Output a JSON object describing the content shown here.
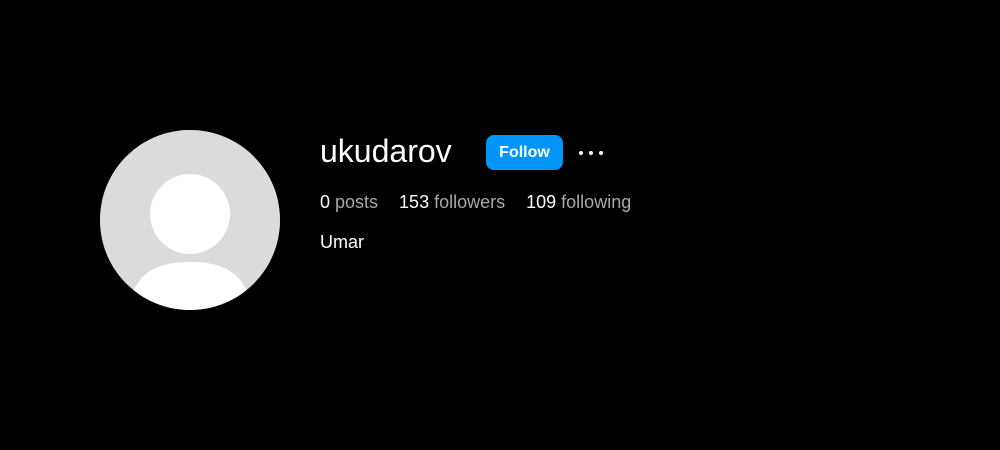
{
  "profile": {
    "username": "ukudarov",
    "full_name": "Umar",
    "avatar_icon": "default-user-icon"
  },
  "actions": {
    "follow_label": "Follow",
    "more_icon": "more-options-icon"
  },
  "stats": {
    "posts_count": "0",
    "posts_label": "posts",
    "followers_count": "153",
    "followers_label": "followers",
    "following_count": "109",
    "following_label": "following"
  },
  "colors": {
    "background": "#000000",
    "accent": "#0095f6",
    "secondary_text": "#a8a8a8",
    "avatar_bg": "#dbdbdb"
  }
}
